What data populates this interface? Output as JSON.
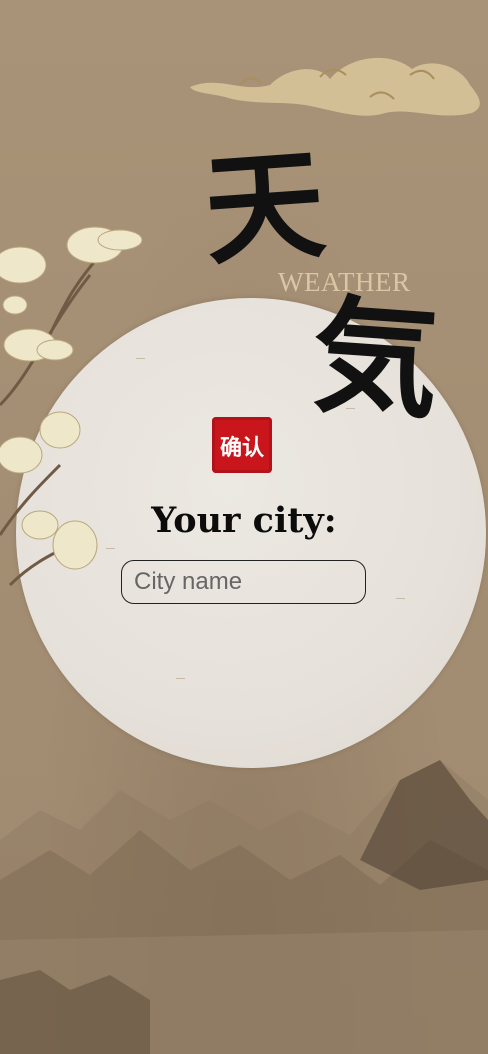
{
  "title": {
    "char_1": "天",
    "char_2": "気",
    "subtitle": "WEATHER"
  },
  "seal": {
    "icon": "red-seal-stamp-icon",
    "text": "确认"
  },
  "form": {
    "label": "Your city:",
    "city_input_value": "",
    "city_input_placeholder": "City name"
  },
  "colors": {
    "background": "#a69177",
    "moon": "#e8e3dc",
    "seal_red": "#c9161d",
    "ink": "#111111",
    "subtitle": "#d8c7a6"
  }
}
